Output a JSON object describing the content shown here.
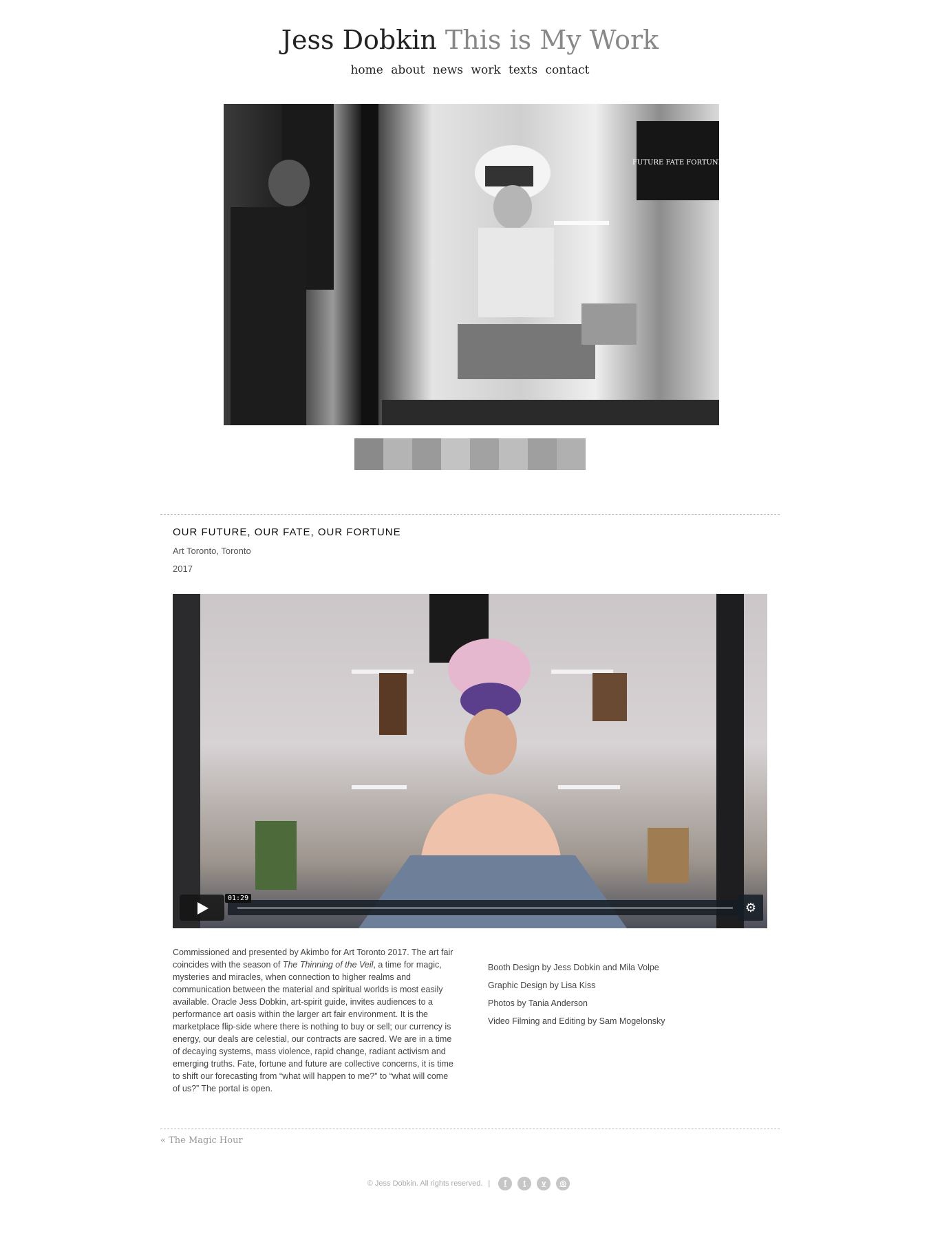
{
  "header": {
    "site_name": "Jess Dobkin",
    "tagline": "This is My Work",
    "nav": [
      "home",
      "about",
      "news",
      "work",
      "texts",
      "contact"
    ]
  },
  "project": {
    "title": "OUR FUTURE, OUR FATE, OUR FORTUNE",
    "place": "Art Toronto, Toronto",
    "year": "2017"
  },
  "video": {
    "timecode": "01:29",
    "play_icon": "play-icon",
    "settings_icon": "gear-icon"
  },
  "description": {
    "before_em": "Commissioned and presented by Akimbo for Art Toronto 2017. The art fair coincides with the season of ",
    "em": "The Thinning of the Veil",
    "after_em": ", a time for magic, mysteries and miracles, when connection to higher realms and communication between the material and spiritual worlds is most easily available. Oracle Jess Dobkin, art-spirit guide, invites audiences to a performance art oasis within the larger art fair environment. It is the marketplace flip-side where there is nothing to buy or sell; our currency is energy, our deals are celestial, our contracts are sacred. We are in a time of decaying systems, mass violence, rapid change, radiant activism and emerging truths. Fate, fortune and future are collective concerns, it is time to shift our forecasting from “what will happen to me?” to “what will come of us?” The portal is open."
  },
  "credits": [
    "Booth Design by Jess Dobkin and Mila Volpe",
    "Graphic Design by Lisa Kiss",
    "Photos by Tania Anderson",
    "Video Filming and Editing by Sam Mogelonsky"
  ],
  "prev_link": "« The Magic Hour",
  "footer": {
    "copyright": "© Jess Dobkin. All rights reserved.",
    "separator": "|",
    "social": [
      {
        "icon": "facebook-icon",
        "glyph": "f"
      },
      {
        "icon": "twitter-icon",
        "glyph": "t"
      },
      {
        "icon": "vimeo-icon",
        "glyph": "v"
      },
      {
        "icon": "instagram-icon",
        "glyph": "◎"
      }
    ]
  },
  "hero_sign_text": "FUTURE FATE FORTUNE",
  "colors": {
    "text": "#333333",
    "muted": "#888888",
    "turban": "#5b3f8c"
  }
}
